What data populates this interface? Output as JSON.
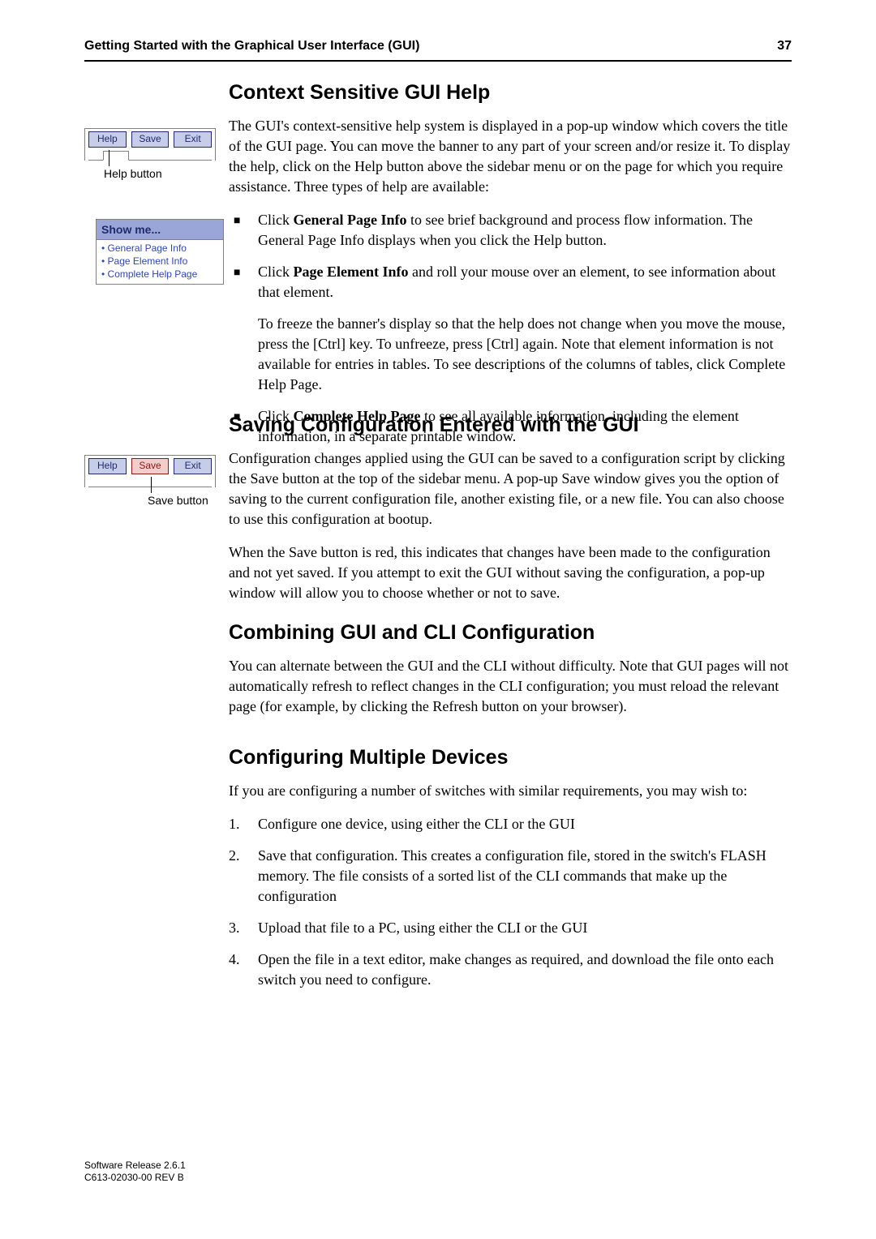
{
  "header": {
    "running_title": "Getting Started with the Graphical User Interface (GUI)",
    "page_number": "37"
  },
  "fig1": {
    "buttons": {
      "help": "Help",
      "save": "Save",
      "exit": "Exit"
    },
    "caption": "Help button"
  },
  "fig_showme": {
    "title": "Show me...",
    "items": [
      "General Page Info",
      "Page Element Info",
      "Complete Help Page"
    ]
  },
  "fig2": {
    "buttons": {
      "help": "Help",
      "save": "Save",
      "exit": "Exit"
    },
    "caption": "Save button"
  },
  "section1": {
    "heading": "Context Sensitive GUI Help",
    "intro": "The GUI's context-sensitive help system is displayed in a pop-up window which covers the title of the GUI page. You can move the banner to any part of your screen and/or resize it. To display the help, click on the Help button above the sidebar menu or on the page for which you require assistance. Three types of help are available:",
    "bullet1_label": "General Page Info",
    "bullet1_rest": " to see brief background and process flow information. The General Page Info displays when you click the Help button.",
    "bullet2_label": "Page Element Info",
    "bullet2_rest": " and roll your mouse over an element, to see information about that element.",
    "bullet2_sub": "To freeze the banner's display so that the help does not change when you move the mouse, press the [Ctrl] key. To unfreeze, press [Ctrl] again. Note that element information is not available for entries in tables. To see descriptions of the columns of tables, click Complete Help Page.",
    "bullet3_label": "Complete Help Page",
    "bullet3_rest": " to see all available information, including the element information, in a separate printable window.",
    "click_label": "Click "
  },
  "section2": {
    "heading": "Saving Configuration Entered with the GUI",
    "p1": "Configuration changes applied using the GUI can be saved to a configuration script by clicking the Save button at the top of the sidebar menu. A pop-up Save window gives you the option of saving to the current configuration file, another existing file, or a new file. You can also choose to use this configuration at bootup.",
    "p2": "When the Save button is red, this indicates that changes have been made to the configuration and not yet saved. If you attempt to exit the GUI without saving the configuration, a pop-up window will allow you to choose whether or not to save."
  },
  "section3": {
    "heading": "Combining GUI and CLI Configuration",
    "p1": "You can alternate between the GUI and the CLI without difficulty. Note that GUI pages will not automatically refresh to reflect changes in the CLI configuration; you must reload the relevant page (for example, by clicking the Refresh button on your browser)."
  },
  "section4": {
    "heading": "Configuring Multiple Devices",
    "intro": "If you are configuring a number of switches with similar requirements, you may wish to:",
    "steps": [
      "Configure one device, using either the CLI or the GUI",
      "Save that configuration. This creates a configuration file, stored in the switch's FLASH memory. The file consists of a sorted list of the CLI commands that make up the configuration",
      "Upload that file to a PC, using either the CLI or the GUI",
      "Open the file in a text editor, make changes as required, and download the file onto each switch you need to configure."
    ],
    "numbers": [
      "1.",
      "2.",
      "3.",
      "4."
    ]
  },
  "footer": {
    "line1": "Software Release 2.6.1",
    "line2": "C613-02030-00 REV B"
  }
}
